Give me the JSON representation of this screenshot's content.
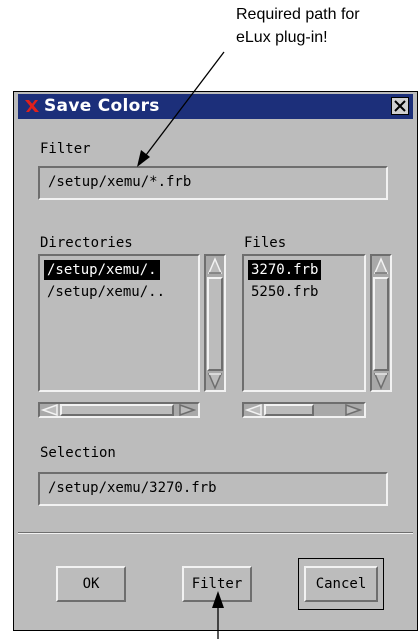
{
  "annotation": {
    "line1": "Required path for",
    "line2": "eLux plug-in!"
  },
  "dialog": {
    "title": "Save Colors",
    "filter_label": "Filter",
    "filter_value": "/setup/xemu/*.frb",
    "directories_label": "Directories",
    "files_label": "Files",
    "directories": [
      {
        "name": "/setup/xemu/.",
        "selected": true
      },
      {
        "name": "/setup/xemu/..",
        "selected": false
      }
    ],
    "files": [
      {
        "name": "3270.frb",
        "selected": true
      },
      {
        "name": "5250.frb",
        "selected": false
      }
    ],
    "selection_label": "Selection",
    "selection_value": "/setup/xemu/3270.frb",
    "buttons": {
      "ok": "OK",
      "filter": "Filter",
      "cancel": "Cancel"
    }
  },
  "colors": {
    "titlebar": "#1c2f7a",
    "dialog_bg": "#bcbcbc",
    "logo_red": "#e0201c"
  },
  "icons": {
    "app_logo": "x-logo-icon",
    "close": "close-icon"
  }
}
